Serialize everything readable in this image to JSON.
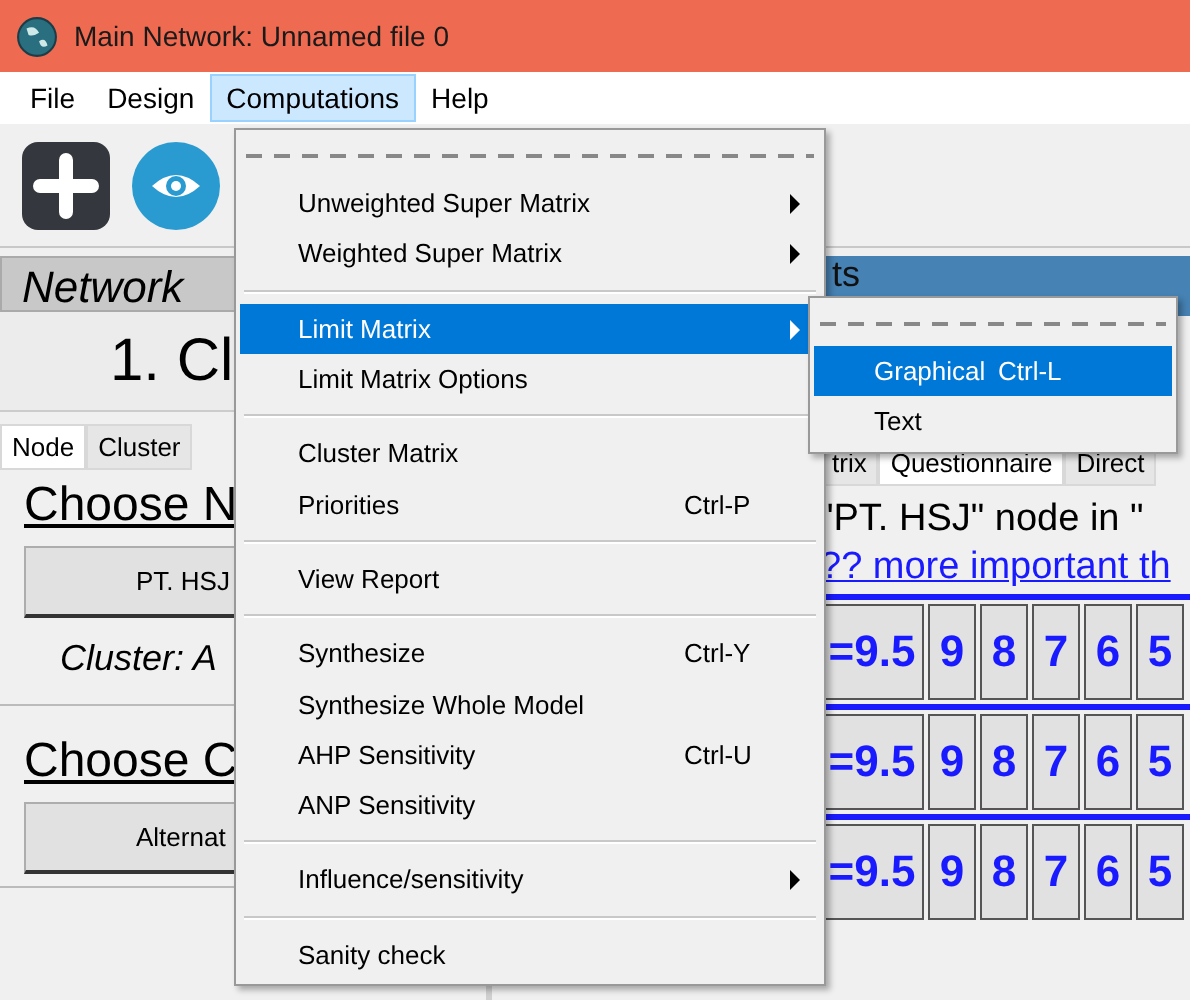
{
  "window": {
    "title": "Main Network: Unnamed file 0"
  },
  "menubar": [
    {
      "label": "File",
      "selected": false
    },
    {
      "label": "Design",
      "selected": false
    },
    {
      "label": "Computations",
      "selected": true
    },
    {
      "label": "Help",
      "selected": false
    }
  ],
  "left_panel": {
    "header": "Network",
    "heading": "1. Cl",
    "tabs": [
      {
        "label": "Node",
        "selected": true
      },
      {
        "label": "Cluster",
        "selected": false
      }
    ],
    "node_title": "Choose N",
    "node_button": "PT. HSJ",
    "cluster_label": "Cluster: A",
    "cluster_title": "Choose C",
    "cluster_button": "Alternat"
  },
  "right_panel": {
    "header": "ts",
    "tabs": [
      {
        "label": "trix",
        "selected": false
      },
      {
        "label": "Questionnaire",
        "selected": true
      },
      {
        "label": "Direct",
        "selected": false
      }
    ],
    "question": "\"PT. HSJ\" node in \"",
    "link": "?? more important th",
    "rows": [
      {
        "value": "=9.5",
        "scale": [
          "9",
          "8",
          "7",
          "6",
          "5"
        ]
      },
      {
        "value": "=9.5",
        "scale": [
          "9",
          "8",
          "7",
          "6",
          "5"
        ]
      },
      {
        "value": "=9.5",
        "scale": [
          "9",
          "8",
          "7",
          "6",
          "5"
        ]
      }
    ]
  },
  "menu": {
    "items": [
      {
        "kind": "tearoff"
      },
      {
        "kind": "item",
        "label": "Unweighted Super Matrix",
        "submenu": true,
        "selected": false
      },
      {
        "kind": "item",
        "label": "Weighted Super Matrix",
        "submenu": true,
        "selected": false
      },
      {
        "kind": "separator"
      },
      {
        "kind": "item",
        "label": "Limit Matrix",
        "submenu": true,
        "selected": true
      },
      {
        "kind": "item",
        "label": "Limit Matrix Options",
        "submenu": false,
        "selected": false
      },
      {
        "kind": "separator"
      },
      {
        "kind": "item",
        "label": "Cluster Matrix",
        "submenu": false,
        "selected": false
      },
      {
        "kind": "item",
        "label": "Priorities",
        "shortcut": "Ctrl-P",
        "submenu": false,
        "selected": false
      },
      {
        "kind": "separator"
      },
      {
        "kind": "item",
        "label": "View Report",
        "submenu": false,
        "selected": false
      },
      {
        "kind": "separator"
      },
      {
        "kind": "item",
        "label": "Synthesize",
        "shortcut": "Ctrl-Y",
        "submenu": false,
        "selected": false
      },
      {
        "kind": "item",
        "label": "Synthesize Whole Model",
        "submenu": false,
        "selected": false
      },
      {
        "kind": "item",
        "label": "AHP Sensitivity",
        "shortcut": "Ctrl-U",
        "submenu": false,
        "selected": false
      },
      {
        "kind": "item",
        "label": "ANP Sensitivity",
        "submenu": false,
        "selected": false
      },
      {
        "kind": "separator"
      },
      {
        "kind": "item",
        "label": "Influence/sensitivity",
        "submenu": true,
        "selected": false
      },
      {
        "kind": "separator"
      },
      {
        "kind": "item",
        "label": "Sanity check",
        "submenu": false,
        "selected": false
      }
    ]
  },
  "submenu": {
    "items": [
      {
        "kind": "tearoff"
      },
      {
        "kind": "item",
        "label": "Graphical",
        "shortcut": "Ctrl-L",
        "submenu": false,
        "selected": true
      },
      {
        "kind": "item",
        "label": "Text",
        "submenu": false,
        "selected": false
      }
    ]
  }
}
